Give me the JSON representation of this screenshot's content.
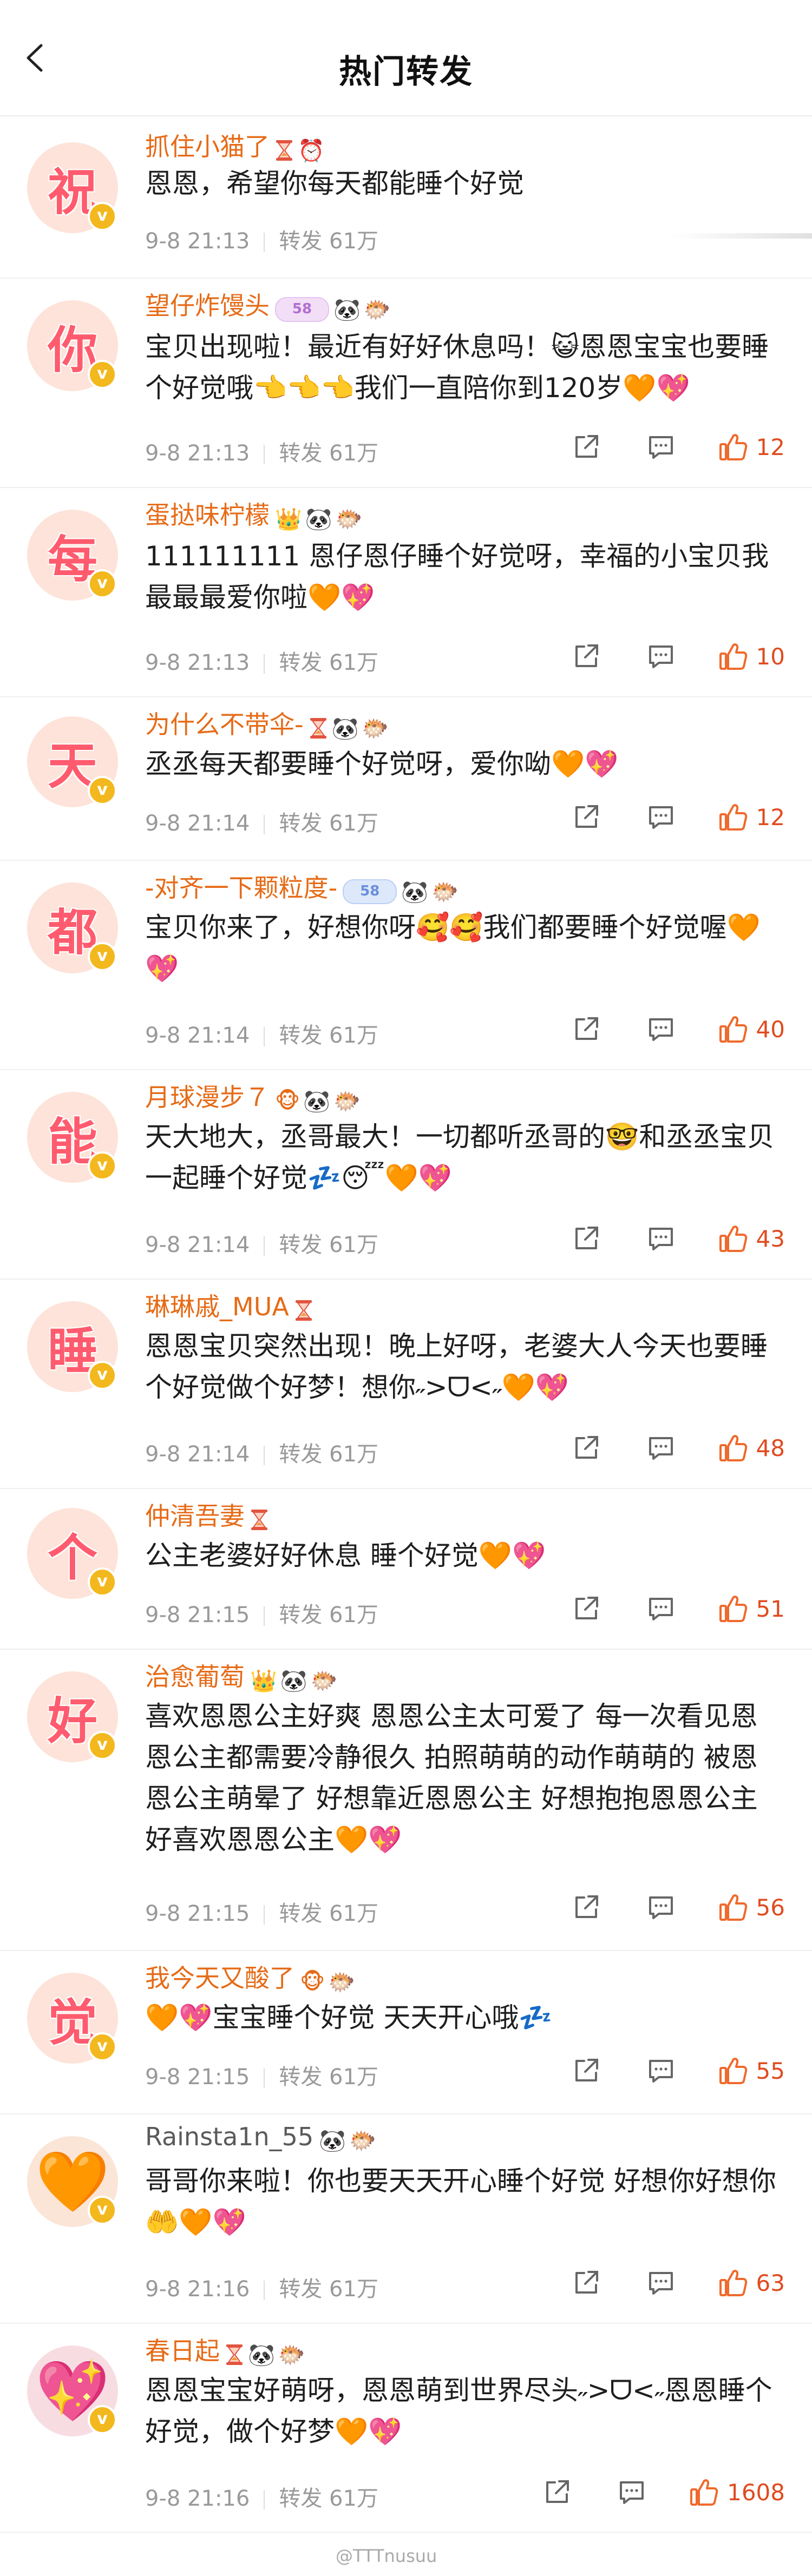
{
  "header": {
    "title": "热门转发"
  },
  "items": [
    {
      "avatar_char": "祝",
      "name": "抓住小猫了",
      "badges": [
        "hourglass",
        "⏰"
      ],
      "text": "恩恩，希望你每天都能睡个好觉",
      "time": "9-8 21:13",
      "repost": "转发 61万",
      "likes": "",
      "show_actions": false
    },
    {
      "avatar_char": "你",
      "name": "望仔炸馒头",
      "badges": [
        "pill-58",
        "🐼",
        "🐡"
      ],
      "text": "宝贝出现啦！最近有好好休息吗！😺恩恩宝宝也要睡个好觉哦👈👈👈我们一直陪你到120岁🧡💖",
      "time": "9-8 21:13",
      "repost": "转发 61万",
      "likes": "12",
      "show_actions": true
    },
    {
      "avatar_char": "每",
      "name": "蛋挞味柠檬",
      "badges": [
        "👑",
        "🐼",
        "🐡"
      ],
      "text": "111111111 恩仔恩仔睡个好觉呀，幸福的小宝贝我最最最爱你啦🧡💖",
      "time": "9-8 21:13",
      "repost": "转发 61万",
      "likes": "10",
      "show_actions": true
    },
    {
      "avatar_char": "天",
      "name": "为什么不带伞-",
      "badges": [
        "hourglass",
        "🐼",
        "🐡"
      ],
      "text": "丞丞每天都要睡个好觉呀，爱你呦🧡💖",
      "time": "9-8 21:14",
      "repost": "转发 61万",
      "likes": "12",
      "show_actions": true
    },
    {
      "avatar_char": "都",
      "name": "-对齐一下颗粒度-",
      "badges": [
        "pill-58-blue",
        "🐼",
        "🐡"
      ],
      "text": "宝贝你来了，好想你呀🥰🥰我们都要睡个好觉喔🧡💖",
      "time": "9-8 21:14",
      "repost": "转发 61万",
      "likes": "40",
      "show_actions": true
    },
    {
      "avatar_char": "能",
      "name": "月球漫步７",
      "badges": [
        "🐵",
        "🐼",
        "🐡"
      ],
      "text": "天大地大，丞哥最大！一切都听丞哥的🤓和丞丞宝贝一起睡个好觉💤😴🧡💖",
      "time": "9-8 21:14",
      "repost": "转发 61万",
      "likes": "43",
      "show_actions": true
    },
    {
      "avatar_char": "睡",
      "name": "琳琳戚_MUA",
      "badges": [
        "hourglass"
      ],
      "text": "恩恩宝贝突然出现！晚上好呀，老婆大人今天也要睡个好觉做个好梦！想你˶>ᗜ<˶🧡💖",
      "time": "9-8 21:14",
      "repost": "转发 61万",
      "likes": "48",
      "show_actions": true
    },
    {
      "avatar_char": "个",
      "name": "仲清吾妻",
      "badges": [
        "hourglass"
      ],
      "text": "公主老婆好好休息 睡个好觉🧡💖",
      "time": "9-8 21:15",
      "repost": "转发 61万",
      "likes": "51",
      "show_actions": true
    },
    {
      "avatar_char": "好",
      "name": "治愈葡萄",
      "badges": [
        "👑",
        "🐼",
        "🐡"
      ],
      "text": "喜欢恩恩公主好爽 恩恩公主太可爱了 每一次看见恩恩公主都需要冷静很久 拍照萌萌的动作萌萌的 被恩恩公主萌晕了 好想靠近恩恩公主 好想抱抱恩恩公主 好喜欢恩恩公主🧡💖",
      "time": "9-8 21:15",
      "repost": "转发 61万",
      "likes": "56",
      "show_actions": true
    },
    {
      "avatar_char": "觉",
      "name": "我今天又酸了",
      "badges": [
        "🐵",
        "🐡"
      ],
      "text": "🧡💖宝宝睡个好觉 天天开心哦💤",
      "time": "9-8 21:15",
      "repost": "转发 61万",
      "likes": "55",
      "show_actions": true
    },
    {
      "avatar_char": "🧡",
      "name": "Rainsta1n_55",
      "badges": [
        "🐼",
        "🐡"
      ],
      "text": "哥哥你来啦！你也要天天开心睡个好觉 好想你好想你🤲🧡💖",
      "time": "9-8 21:16",
      "repost": "转发 61万",
      "likes": "63",
      "show_actions": true
    },
    {
      "avatar_char": "💖",
      "name": "春日起",
      "badges": [
        "hourglass",
        "🐼",
        "🐡"
      ],
      "text": "恩恩宝宝好萌呀，恩恩萌到世界尽头˶>ᗜ<˶恩恩睡个好觉，做个好梦🧡💖",
      "time": "9-8 21:16",
      "repost": "转发 61万",
      "likes": "1608",
      "show_actions": true
    }
  ],
  "watermark": "@TTTnusuu",
  "icons": {
    "back": "back-arrow-icon",
    "share": "share-icon",
    "comment": "comment-icon",
    "like": "thumbs-up-icon"
  },
  "colors": {
    "name": "#e66b17",
    "like": "#e04b1f",
    "meta": "#999999",
    "avatar_char": "#ff5b6e"
  }
}
